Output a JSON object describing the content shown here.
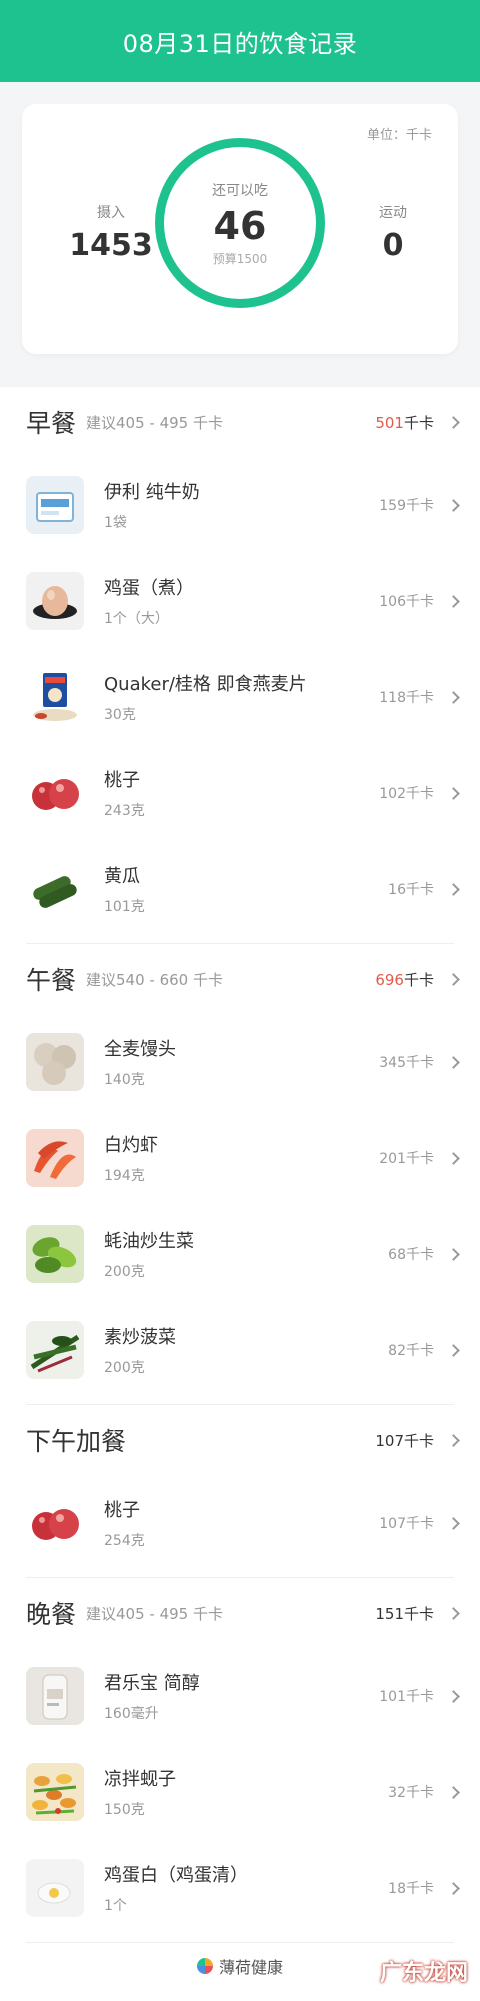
{
  "header": {
    "title": "08月31日的饮食记录"
  },
  "summary": {
    "unit": "单位：千卡",
    "intake_label": "摄入",
    "intake_value": "1453",
    "remaining_label": "还可以吃",
    "remaining_value": "46",
    "budget": "预算1500",
    "exercise_label": "运动",
    "exercise_value": "0",
    "ring_color": "#1ec28e"
  },
  "breakfast": {
    "name": "早餐",
    "hint": "建议405 - 495 千卡",
    "total": "501",
    "unit": "千卡",
    "items": [
      {
        "name": "伊利 纯牛奶",
        "qty": "1袋",
        "kcal": "159千卡",
        "icon": "milk-carton-icon"
      },
      {
        "name": "鸡蛋（煮）",
        "qty": "1个（大）",
        "kcal": "106千卡",
        "icon": "egg-icon"
      },
      {
        "name": "Quaker/桂格 即食燕麦片",
        "qty": "30克",
        "kcal": "118千卡",
        "icon": "oatmeal-bag-icon"
      },
      {
        "name": "桃子",
        "qty": "243克",
        "kcal": "102千卡",
        "icon": "peach-icon"
      },
      {
        "name": "黄瓜",
        "qty": "101克",
        "kcal": "16千卡",
        "icon": "cucumber-icon"
      }
    ]
  },
  "lunch": {
    "name": "午餐",
    "hint": "建议540 - 660 千卡",
    "total": "696",
    "unit": "千卡",
    "items": [
      {
        "name": "全麦馒头",
        "qty": "140克",
        "kcal": "345千卡",
        "icon": "steamed-bun-icon"
      },
      {
        "name": "白灼虾",
        "qty": "194克",
        "kcal": "201千卡",
        "icon": "shrimp-icon"
      },
      {
        "name": "蚝油炒生菜",
        "qty": "200克",
        "kcal": "68千卡",
        "icon": "lettuce-icon"
      },
      {
        "name": "素炒菠菜",
        "qty": "200克",
        "kcal": "82千卡",
        "icon": "spinach-icon"
      }
    ]
  },
  "snack": {
    "name": "下午加餐",
    "total": "107千卡",
    "items": [
      {
        "name": "桃子",
        "qty": "254克",
        "kcal": "107千卡",
        "icon": "peach-icon"
      }
    ]
  },
  "dinner": {
    "name": "晚餐",
    "hint": "建议405 - 495 千卡",
    "total": "151千卡",
    "items": [
      {
        "name": "君乐宝 简醇",
        "qty": "160毫升",
        "kcal": "101千卡",
        "icon": "yogurt-bottle-icon"
      },
      {
        "name": "凉拌蚬子",
        "qty": "150克",
        "kcal": "32千卡",
        "icon": "clam-salad-icon"
      },
      {
        "name": "鸡蛋白（鸡蛋清）",
        "qty": "1个",
        "kcal": "18千卡",
        "icon": "egg-white-icon"
      }
    ]
  },
  "footer": {
    "brand": "薄荷健康",
    "watermark": "广东龙网"
  },
  "colors": {
    "accent": "#1ec28e",
    "over": "#e05b4b"
  }
}
